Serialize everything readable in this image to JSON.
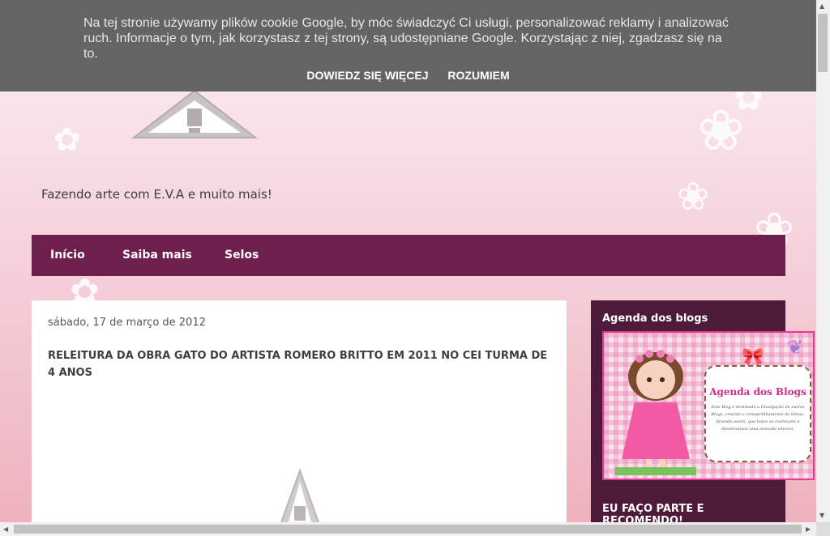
{
  "cookie_bar": {
    "message": "Na tej stronie używamy plików cookie Google, by móc świadczyć Ci usługi, personalizować reklamy i analizować ruch. Informacje o tym, jak korzystasz z tej strony, są udostępniane Google. Korzystając z niej, zgadzasz się na to.",
    "learn_more": "DOWIEDZ SIĘ WIĘCEJ",
    "accept": "ROZUMIEM"
  },
  "header": {
    "tagline": "Fazendo arte com E.V.A e muito mais!"
  },
  "nav": {
    "items": [
      "Início",
      "Saiba mais",
      "Selos"
    ]
  },
  "post": {
    "date": "sábado, 17 de março de 2012",
    "title": "RELEITURA DA OBRA GATO DO ARTISTA ROMERO BRITTO EM 2011 NO CEI TURMA DE 4 ANOS"
  },
  "sidebar": {
    "widget1_title": "Agenda dos blogs",
    "banner_heading": "Agenda dos Blogs",
    "banner_text": "Este Blog é destinado a Divulgação de outros Blogs, criando o compartilhamento de ideias, fazendo assim, que todos se conheçam e desenvolvam uma amizade sincera.",
    "widget2_title": "EU FAÇO PARTE E RECOMENDO!"
  },
  "colors": {
    "nav_bg": "#6e1f4b",
    "sidebar_bg": "#4e1a3a",
    "cookie_bg": "#646464",
    "banner_border": "#e33b95"
  }
}
